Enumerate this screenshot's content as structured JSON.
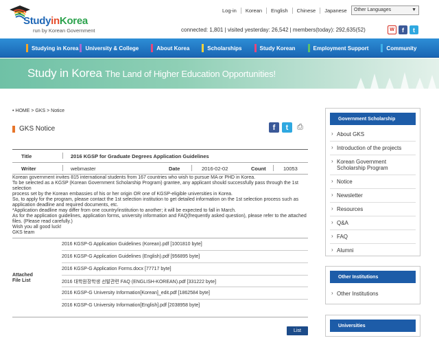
{
  "header": {
    "logo_brand_a": "Study",
    "logo_brand_b": "in",
    "logo_brand_c": "Korea",
    "logo_sub": "run by Korean Government",
    "top_links": [
      "Log-in",
      "Korean",
      "English",
      "Chinese",
      "Japanese"
    ],
    "language_select": "Other Languages",
    "stats": "connected: 1,801 | visited yesterday: 26,542 | members(today): 292,635(52)"
  },
  "nav": {
    "items": [
      {
        "label": "Studying in Korea",
        "color": "#f5a623"
      },
      {
        "label": "University & College",
        "color": "#a66bd3"
      },
      {
        "label": "About Korea",
        "color": "#e8467c"
      },
      {
        "label": "Scholarships",
        "color": "#f7d23c"
      },
      {
        "label": "Study Korean",
        "color": "#e8467c"
      },
      {
        "label": "Employment Support",
        "color": "#5cc06a"
      },
      {
        "label": "Community",
        "color": "#3fb0e8"
      }
    ]
  },
  "banner": {
    "title_a": "Study in Korea",
    "title_b": "The Land of Higher Education Opportunities!"
  },
  "breadcrumb": "• HOME > GKS > Notice",
  "page_title": "GKS Notice",
  "notice": {
    "title_label": "Title",
    "title": "2016 KGSP for Graduate Degrees Application Guidelines",
    "writer_label": "Writer",
    "writer": "webmaster",
    "date_label": "Date",
    "date": "2016-02-02",
    "count_label": "Count",
    "count": "10053",
    "body": [
      "Korean government invites 815 international students from 167 countries who wish to pursue MA or PHD in Korea.",
      "To be selected as a KGSP (Korean Government Scholarship Program) grantee, any applicant should successfully pass through the 1st selection",
      "process set by the Korean embassies of his or her origin OR one of KGSP-eligible universities in Korea.",
      "So, to apply for the program, please contact the 1st selection institution to get detailed information on the 1st selection process such as",
      "application deadline and required documents, etc.",
      "*Application deadline may differ from one country/institution to another; it will be expected to fall in March.",
      "As for the application guidelines, application forms, university information and FAQ(frequently asked question), please refer to the attached",
      "files. (Please read carefully.)",
      "Wish you all good luck!",
      "GKS team"
    ],
    "attached_label_a": "Attached",
    "attached_label_b": "File List",
    "files": [
      "2016 KGSP-G Application Guidelines (Korean).pdf [1001810 byte]",
      "2016 KGSP-G Application Guidelines (English).pdf [956895 byte]",
      "2016 KGSP-G Application Forms.docx [77717 byte]",
      "2016 대학원장학생 선발관련 FAQ (ENGLISH-KOREAN).pdf [331222 byte]",
      "2016 KGSP-G University Information[Korean]_edit.pdf [1862584 byte]",
      "2016 KGSP-G University Information[English].pdf [2038958 byte]"
    ],
    "list_button": "List"
  },
  "sidebar": {
    "gov_head": "Government Scholarship",
    "gov_items": [
      "About GKS",
      "Introduction of the projects",
      "Korean Government Scholarship Program",
      "Notice",
      "Newsletter",
      "Resources",
      "Q&A",
      "FAQ",
      "Alumni"
    ],
    "other_head": "Other Institutions",
    "other_items": [
      "Other Institutions"
    ],
    "univ_head": "Universities"
  }
}
